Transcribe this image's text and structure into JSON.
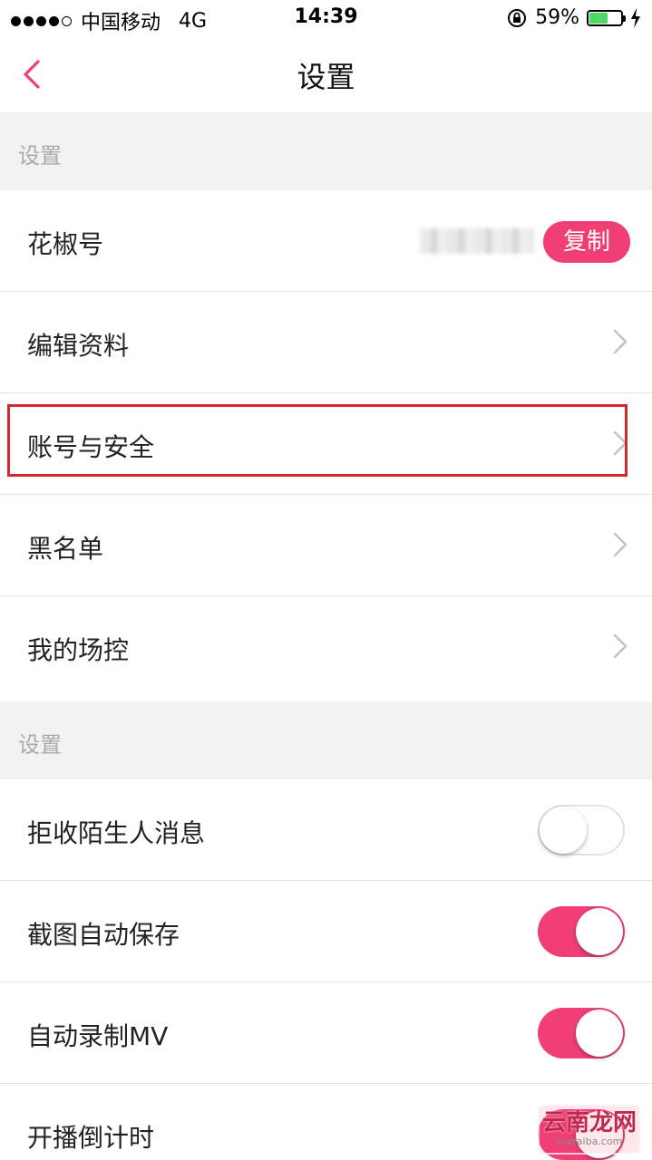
{
  "status_bar": {
    "carrier": "中国移动",
    "network": "4G",
    "time": "14:39",
    "battery_percent": "59%",
    "battery_level": 0.59,
    "battery_color": "#4cd964"
  },
  "nav": {
    "title": "设置",
    "back_icon": "chevron-left-icon"
  },
  "sections": [
    {
      "header": "设置",
      "rows": [
        {
          "label": "花椒号",
          "masked_value": true,
          "action_label": "复制"
        },
        {
          "label": "编辑资料",
          "chevron": true
        },
        {
          "label": "账号与安全",
          "chevron": true,
          "highlighted": true
        },
        {
          "label": "黑名单",
          "chevron": true
        },
        {
          "label": "我的场控",
          "chevron": true
        }
      ]
    },
    {
      "header": "设置",
      "rows": [
        {
          "label": "拒收陌生人消息",
          "toggle": false
        },
        {
          "label": "截图自动保存",
          "toggle": true
        },
        {
          "label": "自动录制MV",
          "toggle": true
        },
        {
          "label": "开播倒计时",
          "toggle": true
        }
      ]
    }
  ],
  "watermark": {
    "text": "云南龙网",
    "url": "xiazaiba.com"
  },
  "colors": {
    "accent": "#f03f75",
    "highlight_border": "#d7282e"
  }
}
